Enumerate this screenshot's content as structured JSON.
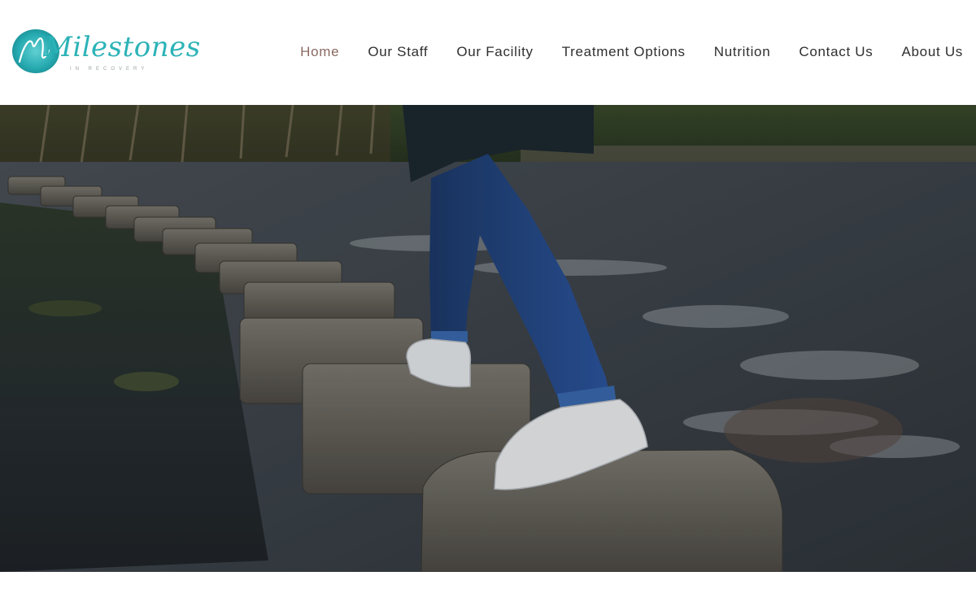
{
  "brand": {
    "logo_text": "Milestones",
    "tagline": "IN RECOVERY",
    "accent": "#2cb3b7"
  },
  "nav": {
    "active_color": "#8a6a62",
    "items": [
      {
        "label": "Home",
        "active": true
      },
      {
        "label": "Our Staff",
        "active": false
      },
      {
        "label": "Our Facility",
        "active": false
      },
      {
        "label": "Treatment Options",
        "active": false
      },
      {
        "label": "Nutrition",
        "active": false
      },
      {
        "label": "Contact Us",
        "active": false
      },
      {
        "label": "About Us",
        "active": false
      }
    ]
  },
  "hero": {
    "image_subject": "person-stepping-on-river-stepping-stones"
  }
}
